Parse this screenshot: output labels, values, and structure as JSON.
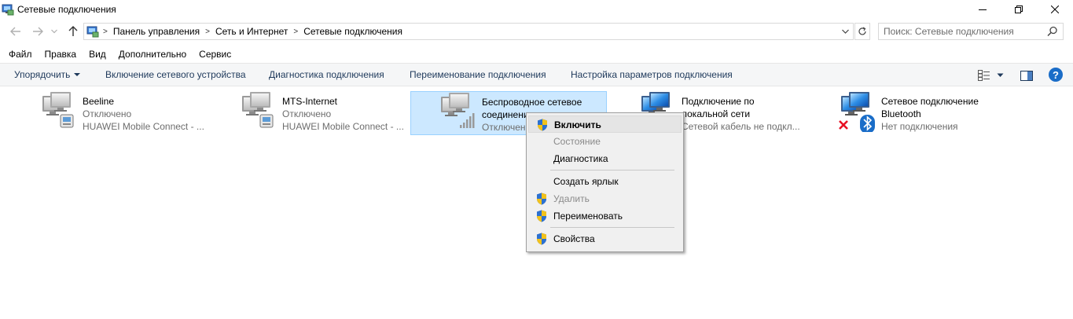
{
  "window": {
    "title": "Сетевые подключения"
  },
  "address": {
    "crumbs": [
      "Панель управления",
      "Сеть и Интернет",
      "Сетевые подключения"
    ]
  },
  "search": {
    "placeholder": "Поиск: Сетевые подключения"
  },
  "menu": {
    "items": [
      "Файл",
      "Правка",
      "Вид",
      "Дополнительно",
      "Сервис"
    ]
  },
  "toolbar": {
    "organize": "Упорядочить",
    "enable_device": "Включение сетевого устройства",
    "diagnose": "Диагностика подключения",
    "rename": "Переименование подключения",
    "settings": "Настройка параметров подключения",
    "help": "?"
  },
  "connections": [
    {
      "name": "Beeline",
      "status": "Отключено",
      "device": "HUAWEI Mobile Connect - ..."
    },
    {
      "name": "MTS-Internet",
      "status": "Отключено",
      "device": "HUAWEI Mobile Connect - ..."
    },
    {
      "name_line1": "Беспроводное сетевое",
      "name_line2": "соединение",
      "status": "Отключено"
    },
    {
      "name_line1": "Подключение по",
      "name_line2": "локальной сети",
      "status": "Сетевой кабель не подкл..."
    },
    {
      "name_line1": "Сетевое подключение",
      "name_line2": "Bluetooth",
      "status": "Нет подключения"
    }
  ],
  "context_menu": {
    "enable": "Включить",
    "status": "Состояние",
    "diagnostics": "Диагностика",
    "shortcut": "Создать ярлык",
    "delete": "Удалить",
    "rename": "Переименовать",
    "properties": "Свойства"
  },
  "colors": {
    "accent": "#1a6dc8",
    "selection": "#cce8ff",
    "error": "#e81123"
  }
}
